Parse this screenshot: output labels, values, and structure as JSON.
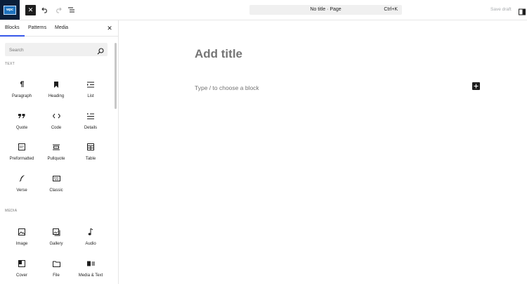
{
  "logo": {
    "text": "wpc"
  },
  "toolbar": {
    "close_label": "✕",
    "undo_icon": "undo-icon",
    "redo_icon": "redo-icon",
    "outline_icon": "list-view-icon",
    "doc_title": "No title · Page",
    "doc_shortcut": "Ctrl+K",
    "save_draft": "Save draft",
    "settings_icon": "sidebar-toggle-icon"
  },
  "inserter": {
    "tabs": [
      {
        "label": "Blocks",
        "active": true
      },
      {
        "label": "Patterns",
        "active": false
      },
      {
        "label": "Media",
        "active": false
      }
    ],
    "close_label": "✕",
    "search": {
      "placeholder": "Search",
      "value": ""
    },
    "sections": [
      {
        "label": "TEXT"
      },
      {
        "label": "MEDIA"
      }
    ],
    "text_blocks": [
      {
        "label": "Paragraph",
        "icon": "paragraph-icon"
      },
      {
        "label": "Heading",
        "icon": "heading-bookmark-icon"
      },
      {
        "label": "List",
        "icon": "list-icon"
      },
      {
        "label": "Quote",
        "icon": "quote-icon"
      },
      {
        "label": "Code",
        "icon": "code-icon"
      },
      {
        "label": "Details",
        "icon": "details-icon"
      },
      {
        "label": "Preformatted",
        "icon": "preformatted-icon"
      },
      {
        "label": "Pullquote",
        "icon": "pullquote-icon"
      },
      {
        "label": "Table",
        "icon": "table-icon"
      },
      {
        "label": "Verse",
        "icon": "verse-icon"
      },
      {
        "label": "Classic",
        "icon": "classic-keyboard-icon"
      }
    ],
    "media_blocks": [
      {
        "label": "Image",
        "icon": "image-icon"
      },
      {
        "label": "Gallery",
        "icon": "gallery-icon"
      },
      {
        "label": "Audio",
        "icon": "audio-icon"
      },
      {
        "label": "Cover",
        "icon": "cover-icon"
      },
      {
        "label": "File",
        "icon": "file-icon"
      },
      {
        "label": "Media & Text",
        "icon": "media-text-icon"
      }
    ]
  },
  "editor": {
    "title_placeholder": "Add title",
    "block_placeholder": "Type / to choose a block",
    "add_block_icon": "plus-icon"
  },
  "colors": {
    "accent": "#3858e9",
    "dark": "#1e1e1e",
    "muted": "#757575",
    "logo_bg": "#0b1f3a"
  }
}
